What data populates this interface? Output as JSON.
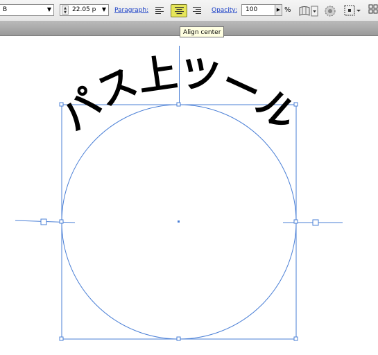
{
  "toolbar": {
    "font_style_value": "B",
    "font_size_value": "22.05 p",
    "paragraph_label": "Paragraph:",
    "opacity_label": "Opacity:",
    "opacity_value": "100",
    "percent_sign": "%"
  },
  "tooltip": {
    "text": "Align center"
  },
  "canvas": {
    "path_text": "パス上ツール",
    "selection_color": "#4a7fd6"
  },
  "colors": {
    "toolbar_bg": "#eaeaea",
    "active_button": "#e6e65a",
    "link": "#1a3fc7"
  }
}
